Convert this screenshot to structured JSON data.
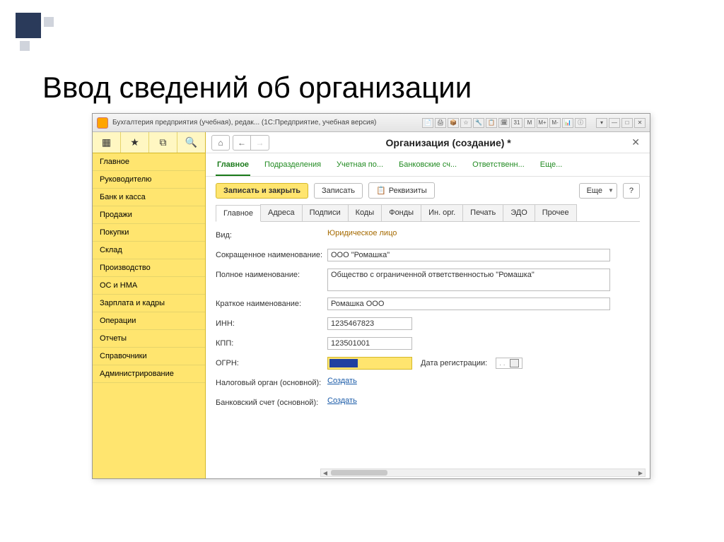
{
  "slide_title": "Ввод сведений об организации",
  "window_title": "Бухгалтерия предприятия (учебная), редак...  (1С:Предприятие, учебная версия)",
  "win_icons": [
    "📄",
    "🖨",
    "📦",
    "☆",
    "🔧",
    "📋",
    "🗓",
    "31",
    "M",
    "M+",
    "M-",
    "📊",
    "ⓘ",
    "▾",
    "—",
    "□",
    "✕"
  ],
  "sidebar_icons": {
    "grid": "▦",
    "star": "★",
    "tab": "⧉",
    "search": "🔍"
  },
  "sidebar": [
    "Главное",
    "Руководителю",
    "Банк и касса",
    "Продажи",
    "Покупки",
    "Склад",
    "Производство",
    "ОС и НМА",
    "Зарплата и кадры",
    "Операции",
    "Отчеты",
    "Справочники",
    "Администрирование"
  ],
  "page": {
    "title": "Организация (создание) *",
    "section_tabs": [
      "Главное",
      "Подразделения",
      "Учетная по...",
      "Банковские сч...",
      "Ответственн...",
      "Еще..."
    ],
    "active_section": 0
  },
  "toolbar": {
    "save_close": "Записать и закрыть",
    "save": "Записать",
    "details": "Реквизиты",
    "more": "Еще",
    "help": "?"
  },
  "inner_tabs": [
    "Главное",
    "Адреса",
    "Подписи",
    "Коды",
    "Фонды",
    "Ин. орг.",
    "Печать",
    "ЭДО",
    "Прочее"
  ],
  "active_inner": 0,
  "form": {
    "type_label": "Вид:",
    "type_value": "Юридическое лицо",
    "short_name_label": "Сокращенное наименование:",
    "short_name_value": "ООО \"Ромашка\"",
    "full_name_label": "Полное наименование:",
    "full_name_value": "Общество с ограниченной ответственностью \"Ромашка\"",
    "brief_name_label": "Краткое наименование:",
    "brief_name_value": "Ромашка ООО",
    "inn_label": "ИНН:",
    "inn_value": "1235467823",
    "kpp_label": "КПП:",
    "kpp_value": "123501001",
    "ogrn_label": "ОГРН:",
    "reg_date_label": "Дата регистрации:",
    "reg_date_value": " .  .    ",
    "tax_org_label": "Налоговый орган (основной):",
    "bank_acct_label": "Банковский счет (основной):",
    "create_link": "Создать"
  }
}
